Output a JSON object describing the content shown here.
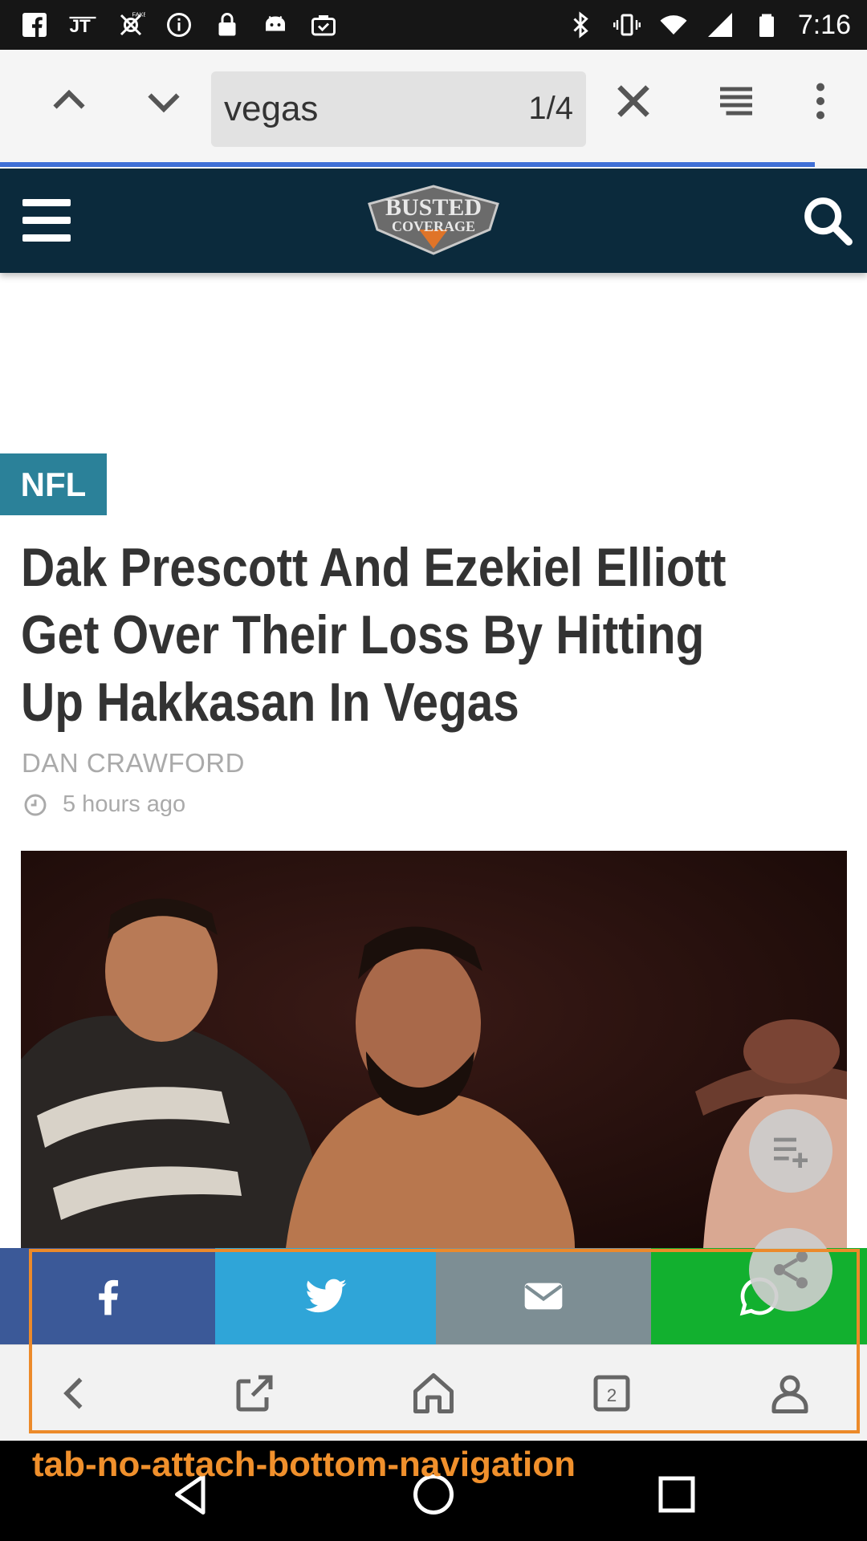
{
  "status_bar": {
    "time": "7:16",
    "left_icons": [
      "facebook-icon",
      "jt-icon",
      "fake-gps-icon",
      "info-icon",
      "lock-icon",
      "android-icon",
      "briefcase-check-icon"
    ],
    "right_icons": [
      "bluetooth-icon",
      "vibrate-icon",
      "wifi-icon",
      "signal-icon",
      "battery-icon"
    ]
  },
  "find_bar": {
    "query": "vegas",
    "match_count": "1/4"
  },
  "site": {
    "logo_alt": "Busted Coverage"
  },
  "article": {
    "category": "NFL",
    "headline": "Dak Prescott And Ezekiel Elliott Get Over Their Loss By Hitting Up Hakkasan In Vegas",
    "author": "DAN CRAWFORD",
    "time_ago": "5 hours ago"
  },
  "share_bar": {
    "buttons": [
      {
        "name": "facebook",
        "color": "#3b5998"
      },
      {
        "name": "twitter",
        "color": "#2fa5d8"
      },
      {
        "name": "email",
        "color": "#7d8e94"
      },
      {
        "name": "whatsapp",
        "color": "#12b02f"
      }
    ]
  },
  "overlay": {
    "label": "tab-no-attach-bottom-navigation",
    "color": "#ec8a2a"
  },
  "colors": {
    "site_header": "#0b2a3c",
    "tag": "#2b8199",
    "find_progress": "#3f6fd6"
  }
}
